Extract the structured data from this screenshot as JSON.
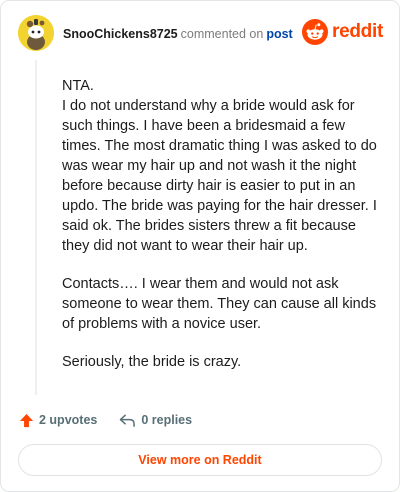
{
  "header": {
    "username": "SnooChickens8725",
    "commented_text": "commented on",
    "post_link_label": "post",
    "brand": "reddit"
  },
  "comment": {
    "paragraphs": [
      "NTA.",
      "I do not understand why a bride would ask for such things. I have been a bridesmaid a few times. The most dramatic thing I was asked to do was wear my hair up and not wash it the night before because dirty hair is easier to put in an updo. The bride was paying for the hair dresser. I said ok. The brides sisters threw a fit because they did not want to wear their hair up.",
      "Contacts…. I wear them and would not ask someone to wear them. They can cause all kinds of problems with a novice user.",
      "Seriously, the bride is crazy."
    ]
  },
  "actions": {
    "upvotes_label": "2 upvotes",
    "replies_label": "0 replies"
  },
  "footer": {
    "view_more_label": "View more on Reddit"
  },
  "colors": {
    "brand_orange": "#ff4500",
    "link_blue": "#0045ac",
    "avatar_yellow": "#f2d32f"
  },
  "icons": {
    "avatar": "snoo-avatar-icon",
    "brand": "reddit-snoo-icon",
    "upvote": "upvote-arrow-icon",
    "reply": "reply-arrow-icon"
  }
}
